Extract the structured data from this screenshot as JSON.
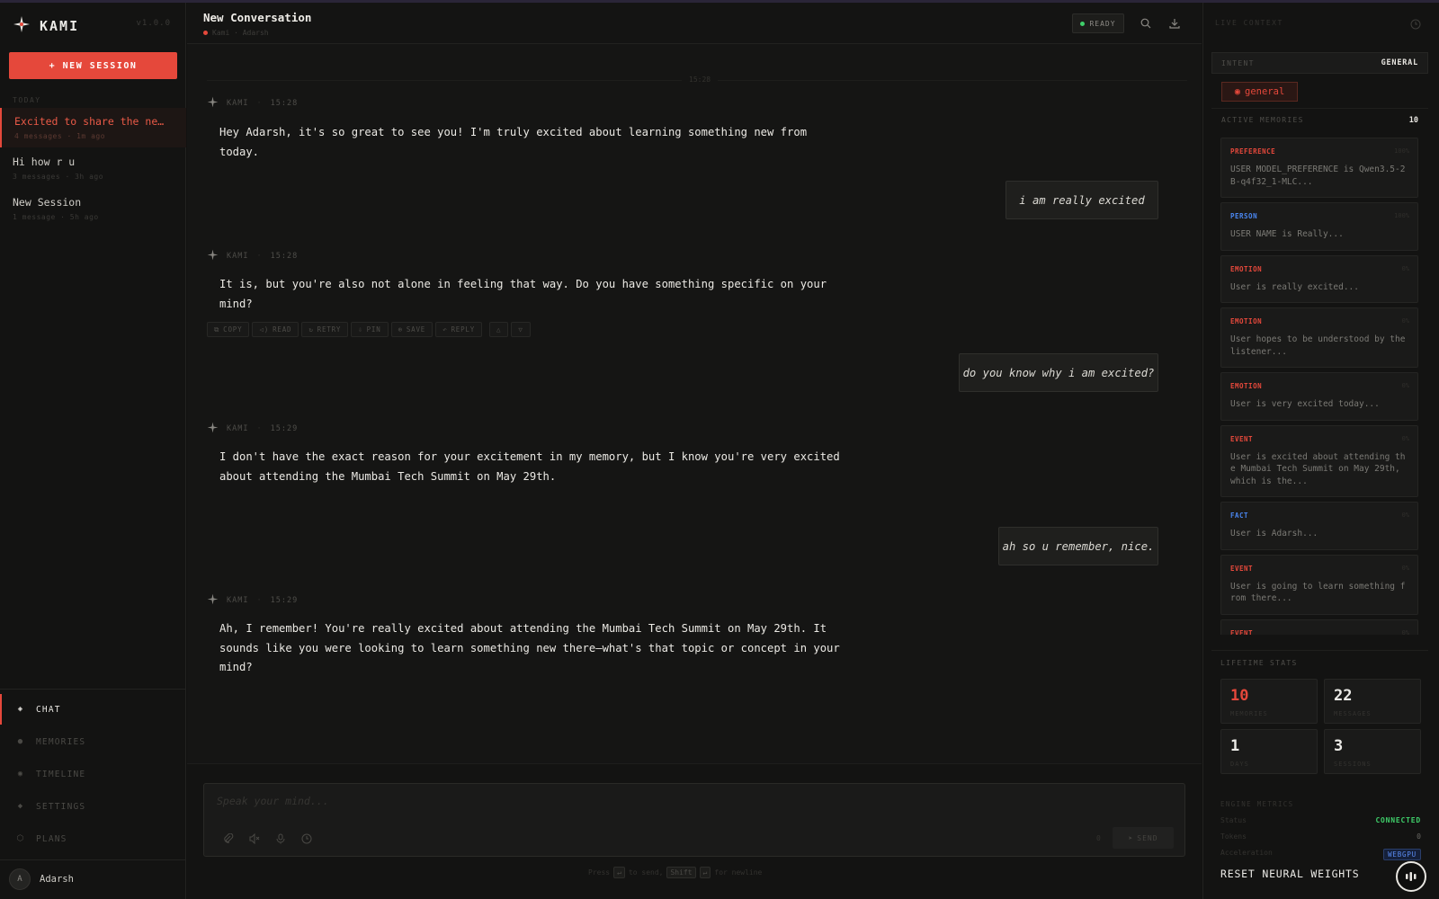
{
  "colors": {
    "accent": "#e5483b",
    "ready": "#3fcf6a",
    "background": "#111110"
  },
  "sidebar": {
    "brand": "KAMI",
    "version": "v1.0.0",
    "new_session": "+ NEW SESSION",
    "section_label": "TODAY",
    "sessions": [
      {
        "title": "Excited to share the ne…",
        "meta": "4 messages · 1m ago"
      },
      {
        "title": "Hi how r u",
        "meta": "3 messages · 3h ago"
      },
      {
        "title": "New Session",
        "meta": "1 message · 5h ago"
      }
    ],
    "nav": [
      {
        "label": "CHAT",
        "icon": "diamond-icon"
      },
      {
        "label": "MEMORIES",
        "icon": "dot-icon"
      },
      {
        "label": "TIMELINE",
        "icon": "dot-icon"
      },
      {
        "label": "SETTINGS",
        "icon": "diamond-icon"
      },
      {
        "label": "PLANS",
        "icon": "hexagon-icon"
      }
    ],
    "user": {
      "initial": "A",
      "name": "Adarsh"
    }
  },
  "header": {
    "title": "New Conversation",
    "subtitle": "Kami · Adarsh",
    "status": "READY"
  },
  "chat": {
    "divider_time": "15:28",
    "bot_name": "KAMI",
    "messages": [
      {
        "time": "15:28",
        "text": "Hey Adarsh, it's so great to see you! I'm truly excited about learning something new from today."
      },
      {
        "user": "i am really excited"
      },
      {
        "time": "15:28",
        "text": "It is, but you're also not alone in feeling that way. Do you have something specific on your mind?"
      },
      {
        "user": "do you know why i am excited?"
      },
      {
        "time": "15:29",
        "text": "I don't have the exact reason for your excitement in my memory, but I know you're very excited about attending the Mumbai Tech Summit on May 29th."
      },
      {
        "user": "ah so u remember, nice."
      },
      {
        "time": "15:29",
        "text": "Ah, I remember! You're really excited about attending the Mumbai Tech Summit on May 29th. It sounds like you were looking to learn something new there—what's that topic or concept in your mind?"
      }
    ],
    "actions": [
      "COPY",
      "READ",
      "RETRY",
      "PIN",
      "SAVE",
      "REPLY"
    ]
  },
  "composer": {
    "placeholder": "Speak your mind...",
    "counter": "0",
    "send": "SEND",
    "hint_press": "Press",
    "hint_enter": "↵",
    "hint_to_send": "to send,",
    "hint_shift": "Shift",
    "hint_newline": "for newline"
  },
  "context": {
    "title": "LIVE CONTEXT",
    "intent_label": "INTENT",
    "intent_value": "GENERAL",
    "intent_tag": "general",
    "memories_label": "ACTIVE MEMORIES",
    "memories_count": "10",
    "memories": [
      {
        "kind": "PREFERENCE",
        "pct": "100%",
        "color": "#e5483b",
        "text": "USER MODEL_PREFERENCE is Qwen3.5-2B-q4f32_1-MLC..."
      },
      {
        "kind": "PERSON",
        "pct": "100%",
        "color": "#4a86f0",
        "text": "USER NAME is Really..."
      },
      {
        "kind": "EMOTION",
        "pct": "0%",
        "color": "#e5483b",
        "text": "User is really excited..."
      },
      {
        "kind": "EMOTION",
        "pct": "0%",
        "color": "#e5483b",
        "text": "User hopes to be understood by the listener..."
      },
      {
        "kind": "EMOTION",
        "pct": "0%",
        "color": "#e5483b",
        "text": "User is very excited today..."
      },
      {
        "kind": "EVENT",
        "pct": "0%",
        "color": "#e5483b",
        "text": "User is excited about attending the Mumbai Tech Summit on May 29th, which is the..."
      },
      {
        "kind": "FACT",
        "pct": "0%",
        "color": "#4a86f0",
        "text": "User is Adarsh..."
      },
      {
        "kind": "EVENT",
        "pct": "0%",
        "color": "#e5483b",
        "text": "User is going to learn something from there..."
      },
      {
        "kind": "EVENT",
        "pct": "0%",
        "color": "#e5483b",
        "text": ""
      }
    ],
    "lifetime_label": "LIFETIME STATS",
    "stats": [
      {
        "n": "10",
        "label": "MEMORIES"
      },
      {
        "n": "22",
        "label": "MESSAGES"
      },
      {
        "n": "1",
        "label": "DAYS"
      },
      {
        "n": "3",
        "label": "SESSIONS"
      }
    ],
    "engine_label": "ENGINE METRICS",
    "engine": [
      {
        "k": "Status",
        "v": "CONNECTED"
      },
      {
        "k": "Tokens",
        "v": "0"
      },
      {
        "k": "Acceleration",
        "v": "WEBGPU"
      }
    ],
    "reset": "RESET NEURAL WEIGHTS"
  }
}
